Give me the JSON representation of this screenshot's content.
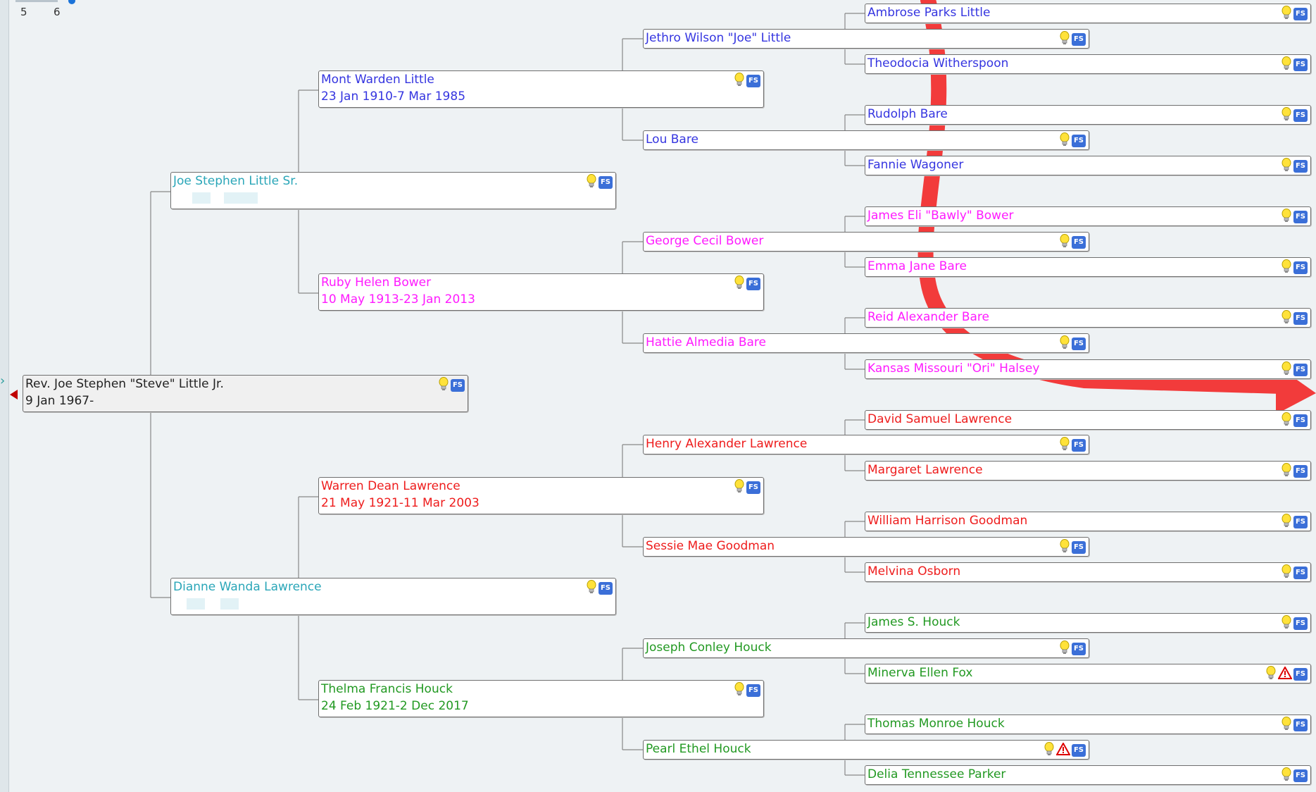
{
  "zoom": {
    "labels": [
      "5",
      "6"
    ]
  },
  "colors": {
    "blue": "#3535e0",
    "teal": "#2aa6b8",
    "magenta": "#ff1aff",
    "red": "#ee1c1c",
    "green": "#229922",
    "dark": "#222222"
  },
  "people": {
    "root": {
      "name": "Rev. Joe Stephen \"Steve\" Little Jr.",
      "dates": "9 Jan 1967-"
    },
    "father": {
      "name": "Joe Stephen Little Sr.",
      "dates": ""
    },
    "mother": {
      "name": "Dianne Wanda Lawrence",
      "dates": ""
    },
    "pgf": {
      "name": "Mont Warden Little",
      "dates": "23 Jan 1910-7 Mar 1985"
    },
    "pgm": {
      "name": "Ruby Helen Bower",
      "dates": "10 May 1913-23 Jan 2013"
    },
    "mgf": {
      "name": "Warren Dean Lawrence",
      "dates": "21 May 1921-11 Mar 2003"
    },
    "mgm": {
      "name": "Thelma Francis Houck",
      "dates": "24 Feb 1921-2 Dec 2017"
    },
    "g1": {
      "name": "Jethro Wilson \"Joe\" Little"
    },
    "g2": {
      "name": "Lou Bare"
    },
    "g3": {
      "name": "George Cecil Bower"
    },
    "g4": {
      "name": "Hattie Almedia Bare"
    },
    "g5": {
      "name": "Henry Alexander Lawrence"
    },
    "g6": {
      "name": "Sessie Mae Goodman"
    },
    "g7": {
      "name": "Joseph Conley Houck"
    },
    "g8": {
      "name": "Pearl Ethel Houck"
    },
    "h1": {
      "name": "Ambrose Parks Little"
    },
    "h2": {
      "name": "Theodocia Witherspoon"
    },
    "h3": {
      "name": "Rudolph Bare"
    },
    "h4": {
      "name": "Fannie Wagoner"
    },
    "h5": {
      "name": "James Eli \"Bawly\" Bower"
    },
    "h6": {
      "name": "Emma Jane Bare"
    },
    "h7": {
      "name": "Reid Alexander Bare"
    },
    "h8": {
      "name": "Kansas Missouri \"Ori\" Halsey"
    },
    "h9": {
      "name": "David Samuel Lawrence"
    },
    "h10": {
      "name": "Margaret Lawrence"
    },
    "h11": {
      "name": "William Harrison Goodman"
    },
    "h12": {
      "name": "Melvina Osborn"
    },
    "h13": {
      "name": "James S. Houck"
    },
    "h14": {
      "name": "Minerva Ellen Fox"
    },
    "h15": {
      "name": "Thomas Monroe Houck"
    },
    "h16": {
      "name": "Delia Tennessee Parker"
    }
  },
  "icons": {
    "hint": "lightbulb-icon",
    "familysearch": "familysearch-icon",
    "warning": "warning-icon",
    "fs_text": "FS"
  }
}
